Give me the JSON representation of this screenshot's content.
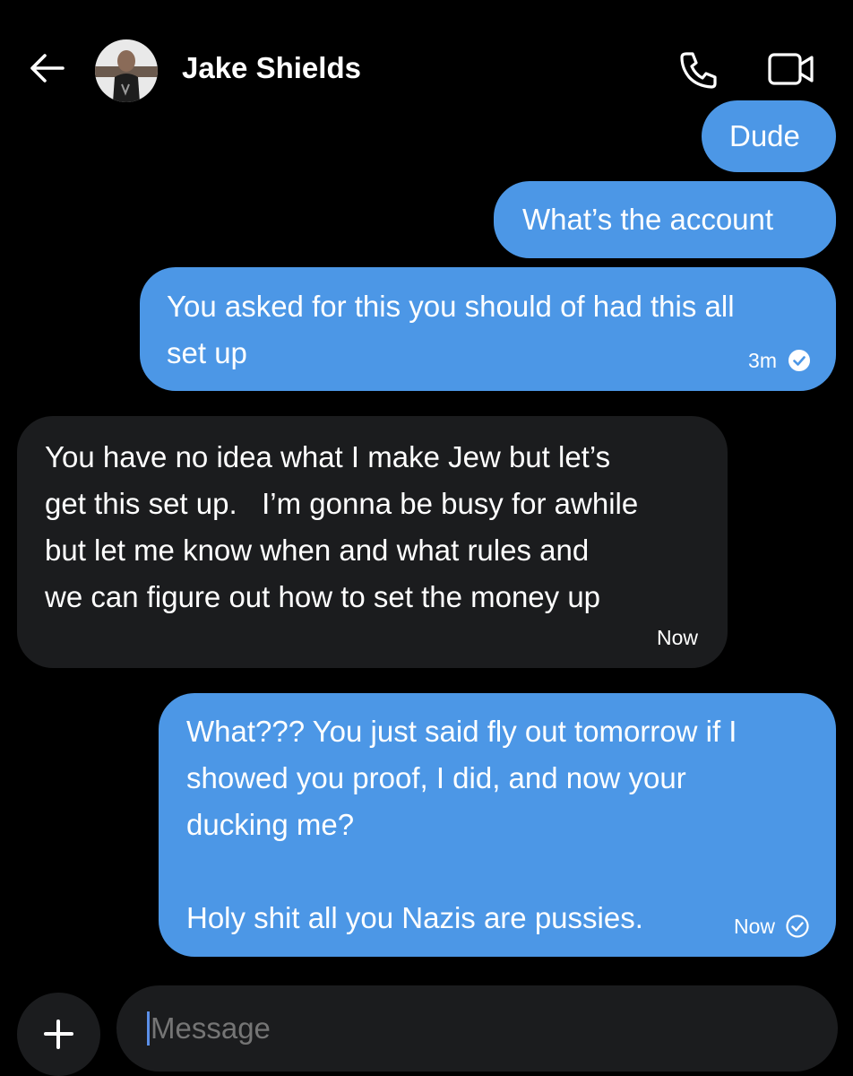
{
  "header": {
    "contact_name": "Jake Shields"
  },
  "messages": [
    {
      "id": "dude",
      "direction": "outgoing",
      "text": "Dude"
    },
    {
      "id": "account",
      "direction": "outgoing",
      "text": "What’s the account"
    },
    {
      "id": "asked",
      "direction": "outgoing",
      "text": "You asked for this you should of had this all\nset up",
      "time": "3m",
      "status": "sent"
    },
    {
      "id": "jew",
      "direction": "incoming",
      "text": "You have no idea what I make Jew but let’s\nget this set up.   I’m gonna be busy for awhile\nbut let me know when and what rules and\nwe can figure out how to set the money up",
      "time": "Now"
    },
    {
      "id": "what",
      "direction": "outgoing",
      "text": "What??? You just said fly out tomorrow if I\nshowed you proof, I did, and now your\nducking me?\n\nHoly shit all you Nazis are pussies.",
      "time": "Now",
      "status": "sent"
    }
  ],
  "composer": {
    "placeholder": "Message"
  },
  "icons": {
    "back": "arrow-left-icon",
    "call": "phone-icon",
    "video": "video-camera-icon",
    "add": "plus-icon",
    "sent": "check-circle-icon"
  },
  "colors": {
    "background": "#000000",
    "outgoing_bubble": "#4c97e6",
    "incoming_bubble": "#1b1c1e",
    "input_background": "#1b1c1e",
    "caret": "#5b8fe8"
  }
}
